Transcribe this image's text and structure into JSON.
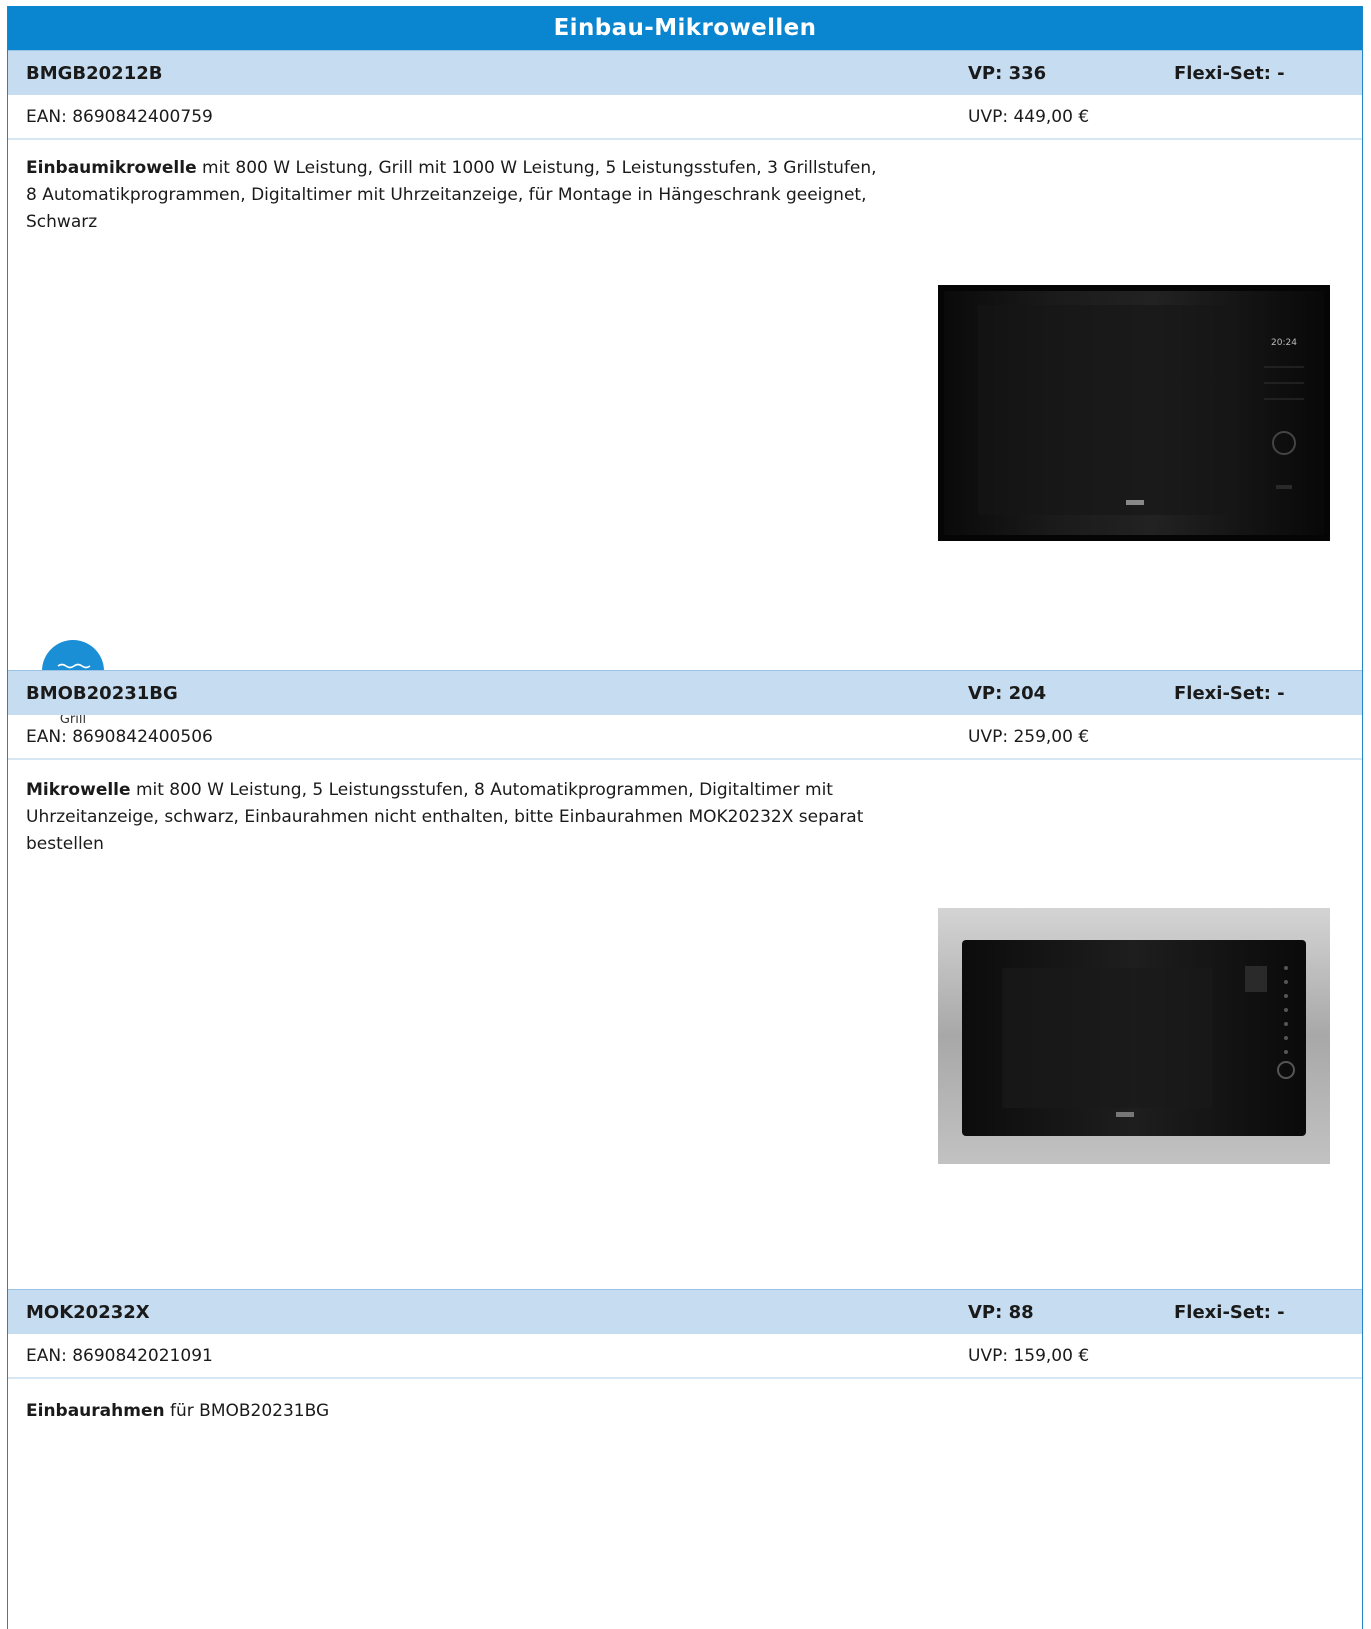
{
  "title": "Einbau-Mikrowellen",
  "products": [
    {
      "model": "BMGB20212B",
      "vp": "VP: 336",
      "flexi": "Flexi-Set: -",
      "ean": "EAN: 8690842400759",
      "uvp": "UVP: 449,00 €",
      "desc_bold": "Einbaumikrowelle",
      "desc_text": " mit 800 W Leistung, Grill mit 1000 W Leistung, 5 Leistungsstufen, 3 Grillstufen, 8 Automatikprogrammen, Digitaltimer mit Uhrzeitanzeige, für Montage in Hängeschrank geeignet, Schwarz",
      "display_text": "20:24",
      "feature_icon": "grill-icon",
      "feature_label": "Grill"
    },
    {
      "model": "BMOB20231BG",
      "vp": "VP: 204",
      "flexi": "Flexi-Set: -",
      "ean": "EAN: 8690842400506",
      "uvp": "UVP: 259,00 €",
      "desc_bold": "Mikrowelle",
      "desc_text": " mit 800 W Leistung, 5 Leistungsstufen, 8 Automatikprogrammen, Digitaltimer mit Uhrzeitanzeige, schwarz, Einbaurahmen nicht enthalten, bitte Einbaurahmen MOK20232X separat bestellen"
    },
    {
      "model": "MOK20232X",
      "vp": "VP: 88",
      "flexi": "Flexi-Set: -",
      "ean": "EAN: 8690842021091",
      "uvp": "UVP: 159,00 €",
      "desc_bold": "Einbaurahmen",
      "desc_text": " für BMOB20231BG"
    }
  ],
  "colors": {
    "title_bar": "#0a85cf",
    "head_row": "#c6dcf0",
    "feature_circle": "#1a8fd6"
  }
}
